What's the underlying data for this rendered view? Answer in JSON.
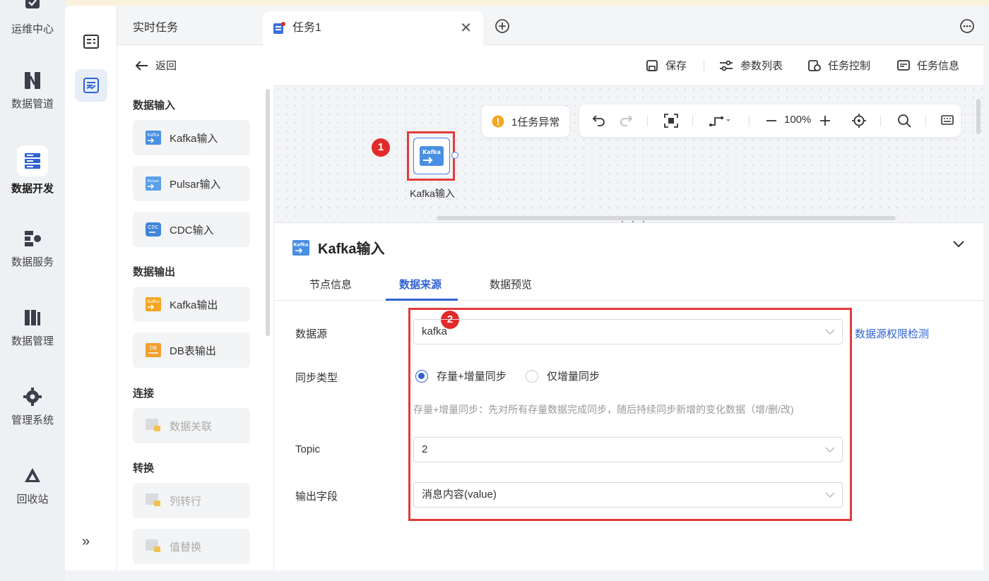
{
  "nav": {
    "items": [
      {
        "label": "运维中心",
        "icon": "monitor-icon"
      },
      {
        "label": "数据管道",
        "icon": "pipeline-icon"
      },
      {
        "label": "数据开发",
        "icon": "dev-icon",
        "active": true
      },
      {
        "label": "数据服务",
        "icon": "service-icon"
      },
      {
        "label": "数据管理",
        "icon": "manage-icon"
      },
      {
        "label": "管理系统",
        "icon": "gear-icon"
      },
      {
        "label": "回收站",
        "icon": "recycle-icon"
      }
    ],
    "expand_glyph": "»"
  },
  "tabs": {
    "inactive_label": "实时任务",
    "active_label": "任务1",
    "close_glyph": "✕"
  },
  "toolbar": {
    "back_label": "返回",
    "save_label": "保存",
    "params_label": "参数列表",
    "control_label": "任务控制",
    "info_label": "任务信息"
  },
  "palette": {
    "groups": {
      "input": "数据输入",
      "output": "数据输出",
      "connect": "连接",
      "transform": "转换"
    },
    "items": {
      "kafka_in": "Kafka输入",
      "pulsar_in": "Pulsar输入",
      "cdc_in": "CDC输入",
      "kafka_out": "Kafka输出",
      "db_out": "DB表输出",
      "join": "数据关联",
      "col_to_row": "列转行",
      "replace": "值替换"
    },
    "icon_text": {
      "kafka": "Kafka",
      "pulsar": "Pulsar",
      "cdc": "CDC",
      "db": "DB"
    }
  },
  "canvas": {
    "warning": "1任务异常",
    "zoom": "100%",
    "node_label": "Kafka输入",
    "node_icon_text": "Kafka",
    "badge1": "1",
    "splitter": "⋮⋮⋮"
  },
  "panel": {
    "title": "Kafka输入",
    "tabs": [
      "节点信息",
      "数据来源",
      "数据预览"
    ],
    "badge2": "2",
    "fields": {
      "datasource_label": "数据源",
      "datasource_value": "kafka",
      "perm_link": "数据源权限检测",
      "sync_label": "同步类型",
      "sync_option1": "存量+增量同步",
      "sync_option2": "仅增量同步",
      "sync_hint": "存量+增量同步：先对所有存量数据完成同步，随后持续同步新增的变化数据（增/删/改)",
      "topic_label": "Topic",
      "topic_value": "2",
      "output_label": "输出字段",
      "output_value": "消息内容(value)"
    }
  },
  "colors": {
    "accent": "#2f62d5",
    "highlight": "#e23b3b",
    "warning": "#f5a623"
  }
}
